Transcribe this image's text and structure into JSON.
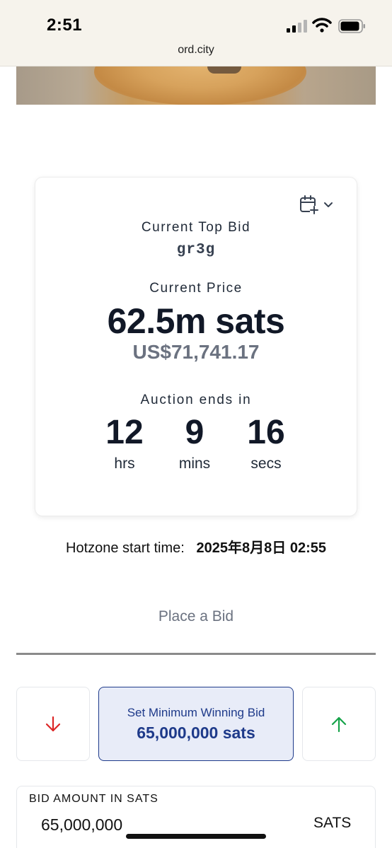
{
  "status_bar": {
    "time": "2:51",
    "url": "ord.city"
  },
  "auction": {
    "top_bid_label": "Current Top Bid",
    "top_bidder": "gr3g",
    "price_label": "Current Price",
    "price": "62.5m sats",
    "usd_price": "US$71,741.17",
    "ends_label": "Auction ends in",
    "countdown": [
      {
        "value": "12",
        "unit": "hrs"
      },
      {
        "value": "9",
        "unit": "mins"
      },
      {
        "value": "16",
        "unit": "secs"
      }
    ]
  },
  "hotzone": {
    "label": "Hotzone start time:",
    "value": "2025年8月8日 02:55"
  },
  "bid": {
    "section_title": "Place a Bid",
    "min_bid_label": "Set Minimum Winning Bid",
    "min_bid_value": "65,000,000 sats",
    "amount_label": "BID AMOUNT IN SATS",
    "amount_value": "65,000,000",
    "amount_unit": "SATS"
  },
  "colors": {
    "accent": "#1e3a8a",
    "decrease_arrow": "#dc2626",
    "increase_arrow": "#16a34a"
  },
  "icons": [
    "signal-icon",
    "wifi-icon",
    "battery-icon",
    "calendar-add-icon",
    "chevron-down-icon",
    "arrow-down-icon",
    "arrow-up-icon"
  ]
}
